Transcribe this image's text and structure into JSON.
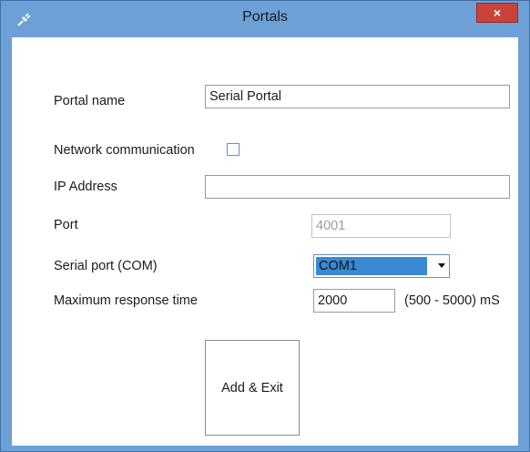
{
  "window": {
    "title": "Portals",
    "close_label": "×",
    "colors": {
      "titlebar": "#6ca0d6",
      "close": "#c8433a",
      "selection": "#3a89d3"
    }
  },
  "form": {
    "portal_name": {
      "label": "Portal name",
      "value": "Serial Portal"
    },
    "network_communication": {
      "label": "Network communication",
      "checked": false
    },
    "ip_address": {
      "label": "IP Address",
      "value": ""
    },
    "port": {
      "label": "Port",
      "value": "4001",
      "enabled": false
    },
    "serial_port": {
      "label": "Serial port (COM)",
      "selected": "COM1"
    },
    "max_response_time": {
      "label": "Maximum response time",
      "value": "2000",
      "range_hint": "(500 - 5000) mS"
    }
  },
  "actions": {
    "add_exit_label": "Add & Exit"
  }
}
